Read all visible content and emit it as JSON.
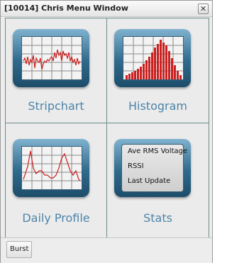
{
  "window": {
    "title": "[10014] Chris Menu Window",
    "close_glyph": "✕"
  },
  "tiles": [
    {
      "label": "Stripchart",
      "icon": "stripchart-icon"
    },
    {
      "label": "Histogram",
      "icon": "histogram-icon"
    },
    {
      "label": "Daily Profile",
      "icon": "daily-profile-icon"
    },
    {
      "label": "Stats",
      "icon": "stats-icon"
    }
  ],
  "stats_lines": [
    "Ave RMS Voltage",
    "RSSI",
    "Last Update"
  ],
  "footer": {
    "burst_label": "Burst"
  },
  "colors": {
    "label_blue": "#4d84aa",
    "trace_red": "#cc1f1f",
    "icon_frame": "#2f6a8c"
  }
}
